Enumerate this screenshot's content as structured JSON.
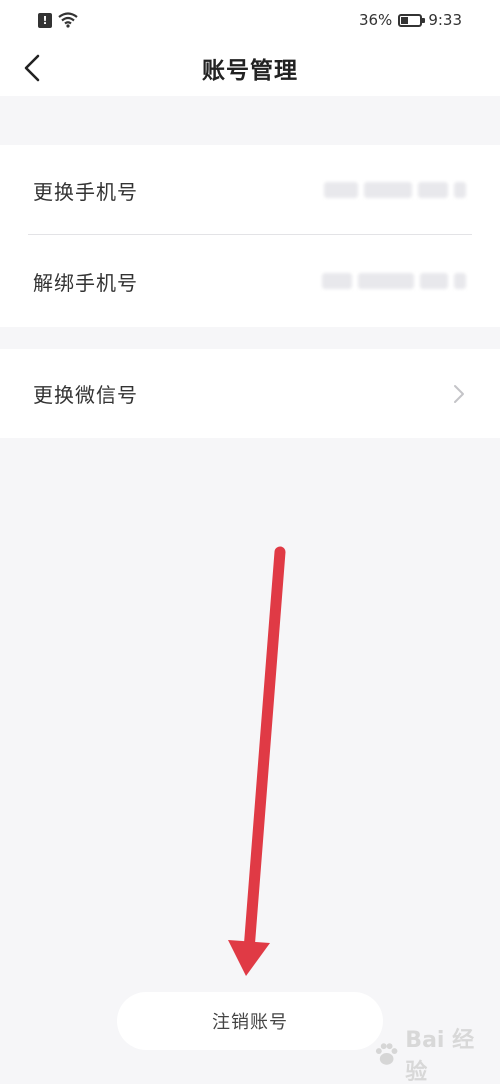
{
  "status_bar": {
    "battery": "36%",
    "time": "9:33",
    "icons": [
      "alert-icon",
      "wifi-icon",
      "battery-icon"
    ]
  },
  "header": {
    "title": "账号管理",
    "back_icon": "chevron-left-icon"
  },
  "settings": {
    "phone_section": [
      {
        "label": "更换手机号",
        "value_masked": true
      },
      {
        "label": "解绑手机号",
        "value_masked": true
      }
    ],
    "wechat_section": [
      {
        "label": "更换微信号",
        "icon": "chevron-right-icon"
      }
    ]
  },
  "footer": {
    "deactivate_label": "注销账号"
  },
  "annotation": {
    "arrow_color": "#e03a45",
    "icon": "arrow-down-icon"
  },
  "watermark": {
    "text": "Bai 经验"
  }
}
